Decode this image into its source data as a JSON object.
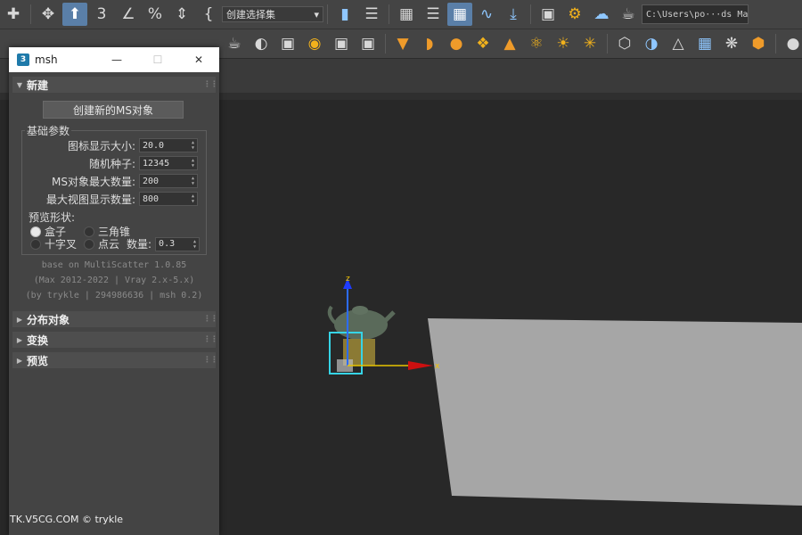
{
  "toolbar": {
    "selection_set": "创建选择集",
    "path": "C:\\Users\\po···ds Ma",
    "snap_label": "3"
  },
  "dialog": {
    "title": "msh",
    "icon_label": "3",
    "rollouts": {
      "new": "新建",
      "distribute": "分布对象",
      "transform": "变换",
      "preview": "预览"
    },
    "create_button": "创建新的MS对象",
    "basic_params": "基础参数",
    "params": [
      {
        "label": "图标显示大小:",
        "value": "20.0"
      },
      {
        "label": "随机种子:",
        "value": "12345"
      },
      {
        "label": "MS对象最大数量:",
        "value": "200"
      },
      {
        "label": "最大视图显示数量:",
        "value": "800"
      }
    ],
    "preview_shape": "预览形状:",
    "shapes": {
      "box": "盒子",
      "pyramid": "三角锥",
      "cross": "十字叉",
      "cloud": "点云"
    },
    "count_label": "数量:",
    "count_value": "0.3",
    "credits": [
      "base on MultiScatter 1.0.85",
      "(Max 2012-2022 | Vray 2.x-5.x)",
      "(by trykle | 294986636 | msh 0.2)"
    ]
  },
  "viewport": {
    "axis_z": "z",
    "axis_x": "x"
  },
  "watermark": "TK.V5CG.COM © trykle"
}
